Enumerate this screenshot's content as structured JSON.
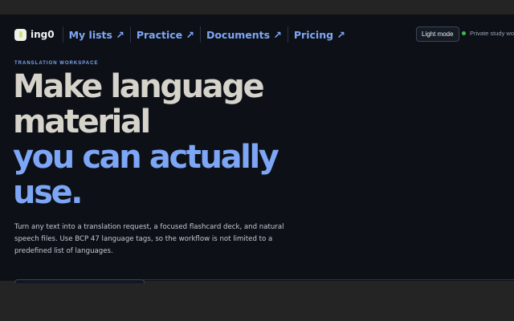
{
  "nav": {
    "logo_text": "ing0",
    "links": [
      {
        "label": "My lists ↗"
      },
      {
        "label": "Practice ↗"
      },
      {
        "label": "Documents ↗"
      },
      {
        "label": "Pricing ↗"
      }
    ]
  },
  "header_right": {
    "theme_button": "Light mode",
    "status_text": "Private study workspace",
    "status_color": "#3fb950"
  },
  "hero": {
    "eyebrow": "TRANSLATION WORKSPACE",
    "line1": "Make language",
    "line2": "material",
    "line3": "you can actually",
    "line4": "use.",
    "lede": "Turn any text into a translation request, a focused flashcard deck, and natural speech files. Use BCP 47 language tags, so the workflow is not limited to a predefined list of languages."
  },
  "colors": {
    "background": "#0d1117",
    "accent": "#7ea6f6",
    "heading": "#d6d3cb"
  }
}
